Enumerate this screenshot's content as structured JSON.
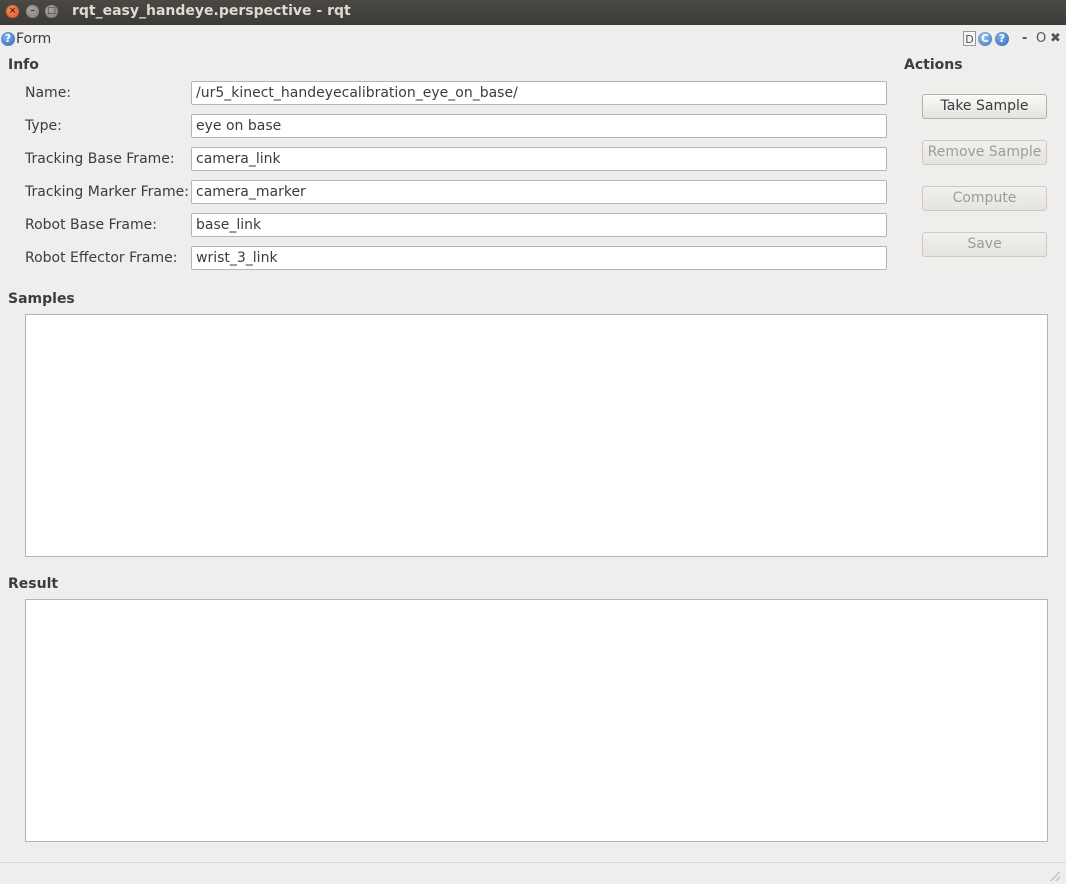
{
  "window": {
    "title": "rqt_easy_handeye.perspective - rqt",
    "close_glyph": "×",
    "min_glyph": "–",
    "max_glyph": "□"
  },
  "plugin": {
    "title": "Form",
    "help_glyph": "?",
    "toolbar": {
      "d_label": "D",
      "reload_glyph": "C",
      "help_glyph": "?",
      "minimize_label": "-",
      "float_label": "O",
      "close_label": "✖"
    }
  },
  "info": {
    "section_label": "Info",
    "fields": [
      {
        "label": "Name:",
        "value": "/ur5_kinect_handeyecalibration_eye_on_base/"
      },
      {
        "label": "Type:",
        "value": "eye on base"
      },
      {
        "label": "Tracking Base Frame:",
        "value": "camera_link"
      },
      {
        "label": "Tracking Marker Frame:",
        "value": "camera_marker"
      },
      {
        "label": "Robot Base Frame:",
        "value": "base_link"
      },
      {
        "label": "Robot Effector Frame:",
        "value": "wrist_3_link"
      }
    ]
  },
  "actions": {
    "section_label": "Actions",
    "take_sample": "Take Sample",
    "remove_sample": "Remove Sample",
    "compute": "Compute",
    "save": "Save"
  },
  "samples": {
    "section_label": "Samples"
  },
  "result": {
    "section_label": "Result"
  },
  "colors": {
    "titlebar": "#3c3b37",
    "window_bg": "#efeeed",
    "close_button": "#e0501f",
    "help_icon": "#2d67b5"
  },
  "icons": [
    "close-icon",
    "minimize-icon",
    "maximize-icon",
    "help-icon",
    "reload-icon"
  ]
}
